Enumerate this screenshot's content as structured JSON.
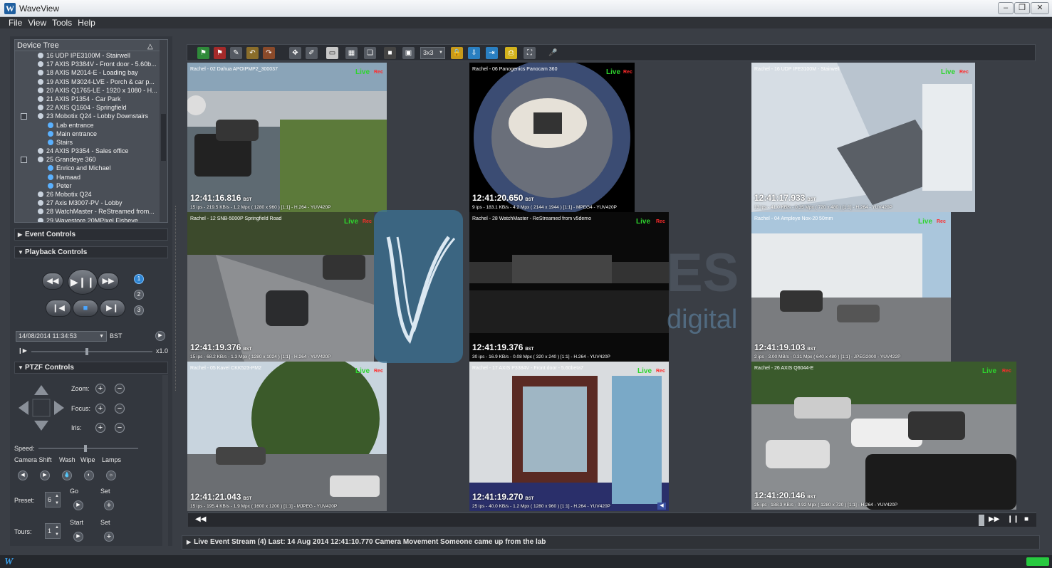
{
  "app": {
    "title": "WaveView"
  },
  "menu": [
    "File",
    "View",
    "Tools",
    "Help"
  ],
  "device_tree": {
    "header": "Device Tree",
    "items": [
      {
        "label": "16 UDP IPE3100M - Stairwell",
        "level": 1
      },
      {
        "label": "17 AXIS P3384V - Front door - 5.60b...",
        "level": 1
      },
      {
        "label": "18 AXIS M2014-E - Loading bay",
        "level": 1
      },
      {
        "label": "19 AXIS M3024-LVE - Porch & car p...",
        "level": 1
      },
      {
        "label": "20 AXIS Q1765-LE - 1920 x 1080 - H...",
        "level": 1
      },
      {
        "label": "21 AXIS P1354 - Car Park",
        "level": 1
      },
      {
        "label": "22 AXIS Q1604 - Springfield",
        "level": 1
      },
      {
        "label": "23 Mobotix Q24 - Lobby Downstairs",
        "level": 1,
        "expander": true
      },
      {
        "label": "Lab entrance",
        "level": 2
      },
      {
        "label": "Main entrance",
        "level": 2
      },
      {
        "label": "Stairs",
        "level": 2
      },
      {
        "label": "24 AXIS P3354 - Sales office",
        "level": 1
      },
      {
        "label": "25 Grandeye 360",
        "level": 1,
        "expander": true
      },
      {
        "label": "Enrico and Michael",
        "level": 2
      },
      {
        "label": "Hamaad",
        "level": 2
      },
      {
        "label": "Peter",
        "level": 2
      },
      {
        "label": "26 Mobotix Q24",
        "level": 1
      },
      {
        "label": "27 Axis M3007-PV - Lobby",
        "level": 1
      },
      {
        "label": "28 WatchMaster - ReStreamed from...",
        "level": 1
      },
      {
        "label": "29 Wavestore 20MPixel Fisheye",
        "level": 1
      }
    ]
  },
  "sections": {
    "event_controls": "Event Controls",
    "playback_controls": "Playback Controls",
    "ptzf_controls": "PTZF Controls"
  },
  "playback": {
    "speed_indicators": [
      "1",
      "2",
      "3"
    ],
    "datetime": "14/08/2014 11:34:53",
    "timezone": "BST",
    "speed": "x1.0"
  },
  "ptzf": {
    "zoom_label": "Zoom:",
    "focus_label": "Focus:",
    "iris_label": "Iris:",
    "speed_label": "Speed:",
    "camera_shift_label": "Camera Shift",
    "wash_label": "Wash",
    "wipe_label": "Wipe",
    "lamps_label": "Lamps",
    "go_label": "Go",
    "set_label": "Set",
    "preset_label": "Preset:",
    "preset_value": "6",
    "start_label": "Start",
    "set2_label": "Set",
    "tours_label": "Tours:",
    "tours_value": "1"
  },
  "toolbar": {
    "layout_value": "3x3"
  },
  "tiles": [
    {
      "caption": "Rachel - 02 Dahua APOIPMP2_300037",
      "time": "12:41:16.816",
      "zone": "BST",
      "info": "15 ips  -  219.5 KB/s  -  1.2 Mpx  ( 1280 x 960 ) [1:1]  -  H.264  -  YUV420P",
      "live": "Live",
      "rec": "Rec"
    },
    {
      "caption": "Rachel - 06 Panogenics Panocam 360",
      "time": "12:41:20.650",
      "zone": "BST",
      "info": "9 ips  -  183.1 KB/s  -  4.2 Mpx  ( 2144 x 1944 ) [1:1]  -  MPEG4  -  YUV420P",
      "live": "Live",
      "rec": "Rec"
    },
    {
      "caption": "Rachel - 16 UDP IPE3100M - Stairwell",
      "time": "12:41:17.933",
      "zone": "BST",
      "info": "13 ips  -  41.0 KB/s  -  0.35 Mpx  ( 720 x 480 ) [1:1]  -  H.264  -  YUV420P",
      "live": "Live",
      "rec": "Rec"
    },
    {
      "caption": "Rachel - 12 SNB-5000P Springfield Road",
      "time": "12:41:19.376",
      "zone": "BST",
      "info": "15 ips  -  68.2 KB/s  -  1.3 Mpx  ( 1280 x 1024 ) [1:1]  -  H.264  -  YUV420P",
      "live": "Live",
      "rec": "Rec"
    },
    {
      "caption": "Rachel - 28 WatchMaster - ReStreamed from v5demo",
      "time": "12:41:19.376",
      "zone": "BST",
      "info": "30 ips  -  16.9 KB/s  -  0.08 Mpx  ( 320 x 240 ) [1:1]  -  H.264  -  YUV420P",
      "live": "Live",
      "rec": "Rec"
    },
    {
      "caption": "Rachel - 04 Ampleye Nox-20 50mm",
      "time": "12:41:19.103",
      "zone": "BST",
      "info": "2 ips  -  3.00 MB/s  -  0.31 Mpx  ( 640 x 480 ) [1:1]  -  JPEG2000  -  YUV422P",
      "live": "Live",
      "rec": "Rec"
    },
    {
      "caption": "Rachel - 05 Kavel CKK523-PM2",
      "time": "12:41:21.043",
      "zone": "BST",
      "info": "15 ips  -  195.4 KB/s  -  1.9 Mpx  ( 1600 x 1200 ) [1:1]  -  MJPEG  -  YUV420P",
      "live": "Live",
      "rec": "Rec"
    },
    {
      "caption": "Rachel - 17 AXIS P3384V - Front door - 5.60beta7",
      "time": "12:41:19.270",
      "zone": "BST",
      "info": "25 ips  -  40.0 KB/s  -  1.2 Mpx  ( 1280 x 960 ) [1:1]  -  H.264  -  YUV420P",
      "live": "Live",
      "rec": "Rec"
    },
    {
      "caption": "Rachel - 26 AXIS Q6044-E",
      "time": "12:41:20.146",
      "zone": "BST",
      "info": "25 ips  -  188.3 KB/s  -  0.92 Mpx  ( 1280 x 720 ) [1:1]  -  H.264  -  YUV420P",
      "live": "Live",
      "rec": "Rec"
    }
  ],
  "event_stream": {
    "text": "Live Event Stream (4)   Last: 14 Aug 2014 12:41:10.770  Camera Movement  Someone came up from the lab"
  },
  "colors": {
    "accent": "#1e9be0",
    "live": "#2ed52e",
    "rec": "#ff2b2b",
    "panel": "#33373e"
  }
}
